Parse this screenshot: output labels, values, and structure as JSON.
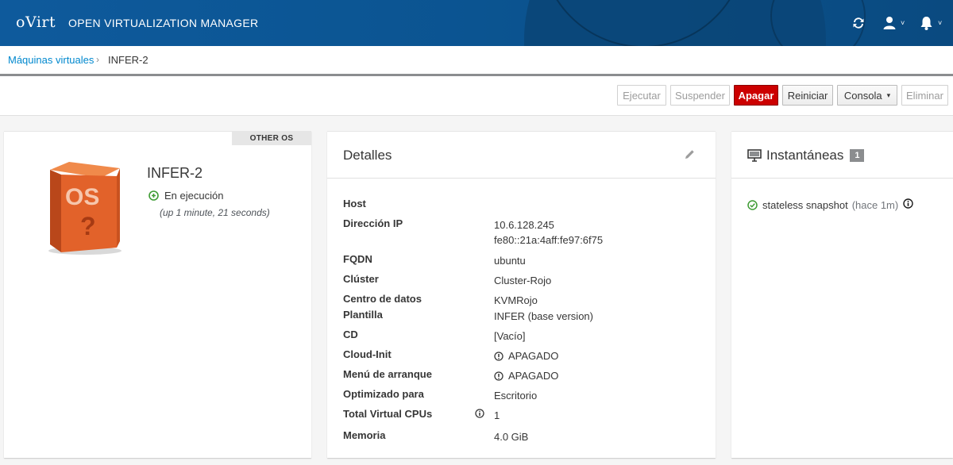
{
  "header": {
    "logo": "oVirt",
    "product": "OPEN VIRTUALIZATION MANAGER",
    "icons": [
      "refresh-icon",
      "user-icon",
      "bell-icon"
    ],
    "user_caret": "˅",
    "bell_caret": "˅"
  },
  "breadcrumb": {
    "parent": "Máquinas virtuales",
    "separator": "›",
    "current": "INFER-2"
  },
  "toolbar": {
    "buttons": [
      {
        "label": "Ejecutar",
        "state": "disabled"
      },
      {
        "label": "Suspender",
        "state": "disabled"
      },
      {
        "label": "Apagar",
        "state": "danger"
      },
      {
        "label": "Reiniciar",
        "state": "enabled"
      },
      {
        "label": "Consola",
        "state": "enabled",
        "dropdown": true
      },
      {
        "label": "Eliminar",
        "state": "disabled"
      }
    ]
  },
  "vm": {
    "os_badge": "OTHER OS",
    "name": "INFER-2",
    "status": "En ejecución",
    "uptime": "(up 1 minute, 21 seconds)",
    "image_text": "OS",
    "image_mark": "?"
  },
  "details": {
    "title": "Detalles",
    "rows": [
      {
        "key": "Host",
        "value": ""
      },
      {
        "key": "Dirección IP",
        "value": "10.6.128.245",
        "value2": "fe80::21a:4aff:fe97:6f75"
      },
      {
        "key": "FQDN",
        "value": "ubuntu"
      },
      {
        "key": "Clúster",
        "value": "Cluster-Rojo"
      },
      {
        "key": "Centro de datos",
        "value": "KVMRojo"
      },
      {
        "key": "Plantilla",
        "value": "INFER (base version)"
      },
      {
        "key": "CD",
        "value": "[Vacío]"
      },
      {
        "key": "Cloud-Init",
        "value": "APAGADO"
      },
      {
        "key": "Menú de arranque",
        "value": "APAGADO"
      },
      {
        "key": "Optimizado para",
        "value": "Escritorio"
      },
      {
        "key": "Total Virtual CPUs",
        "value": "1"
      },
      {
        "key": "Memoria",
        "value": "4.0 GiB"
      }
    ]
  },
  "snapshots": {
    "title": "Instantáneas",
    "count": "1",
    "items": [
      {
        "name": "stateless snapshot",
        "ago": "(hace 1m)"
      }
    ]
  },
  "colors": {
    "header_bg": "#0b5491",
    "link": "#0088ce",
    "danger": "#cc0000",
    "ok": "#3f9c35"
  }
}
